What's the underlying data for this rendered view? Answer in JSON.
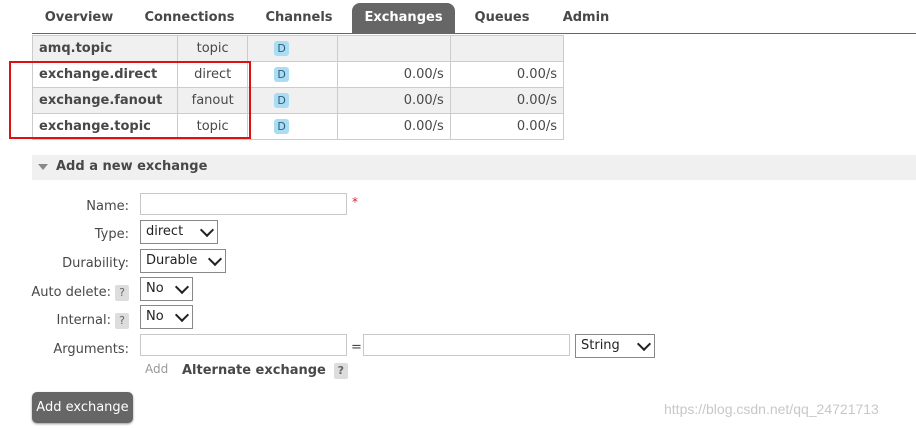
{
  "tabs": [
    {
      "label": "Overview",
      "active": false
    },
    {
      "label": "Connections",
      "active": false
    },
    {
      "label": "Channels",
      "active": false
    },
    {
      "label": "Exchanges",
      "active": true
    },
    {
      "label": "Queues",
      "active": false
    },
    {
      "label": "Admin",
      "active": false
    }
  ],
  "exchanges": [
    {
      "name": "amq.topic",
      "type": "topic",
      "feature": "D",
      "rate_in": "",
      "rate_out": ""
    },
    {
      "name": "exchange.direct",
      "type": "direct",
      "feature": "D",
      "rate_in": "0.00/s",
      "rate_out": "0.00/s"
    },
    {
      "name": "exchange.fanout",
      "type": "fanout",
      "feature": "D",
      "rate_in": "0.00/s",
      "rate_out": "0.00/s"
    },
    {
      "name": "exchange.topic",
      "type": "topic",
      "feature": "D",
      "rate_in": "0.00/s",
      "rate_out": "0.00/s"
    }
  ],
  "add_section": {
    "title": "Add a new exchange",
    "labels": {
      "name": "Name:",
      "type": "Type:",
      "durability": "Durability:",
      "auto_delete": "Auto delete:",
      "internal": "Internal:",
      "arguments": "Arguments:"
    },
    "help_glyph": "?",
    "required_mark": "*",
    "type_value": "direct",
    "durability_value": "Durable",
    "auto_delete_value": "No",
    "internal_value": "No",
    "arguments_equals": "=",
    "arguments_type_value": "String",
    "add_link": "Add",
    "alternate_exchange": "Alternate exchange",
    "submit_label": "Add exchange"
  },
  "watermark": "https://blog.csdn.net/qq_24721713",
  "colors": {
    "tab_active": "#666666",
    "highlight": "#dd1111",
    "badge": "#aadcf3"
  }
}
